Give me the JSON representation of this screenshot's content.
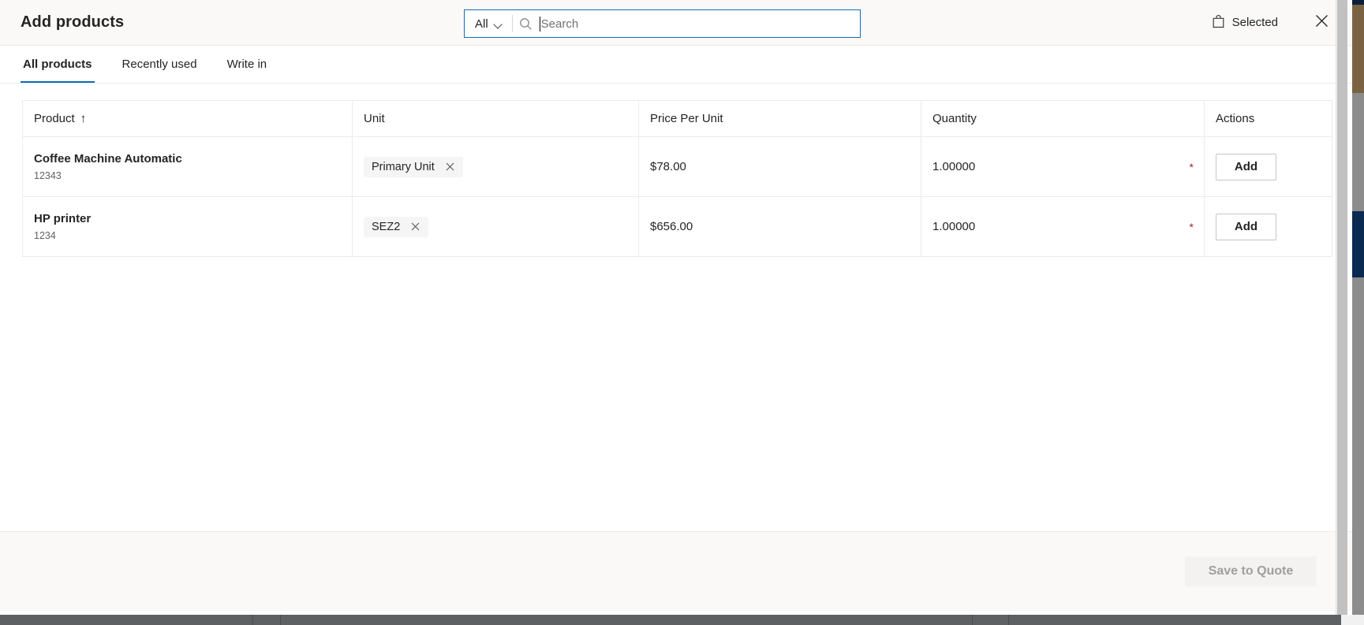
{
  "header": {
    "title": "Add products",
    "search": {
      "scope_label": "All",
      "scope_icon": "chevron-down-icon",
      "search_icon": "search-icon",
      "placeholder": "Search",
      "value": ""
    },
    "selected_label": "Selected",
    "selected_icon": "shopping-bag-icon",
    "close_icon": "close-icon",
    "accent_color": "#0f6cbd"
  },
  "tabs": [
    {
      "label": "All products",
      "active": true
    },
    {
      "label": "Recently used",
      "active": false
    },
    {
      "label": "Write in",
      "active": false
    }
  ],
  "table": {
    "columns": [
      {
        "label": "Product",
        "sort_indicator": "↑"
      },
      {
        "label": "Unit",
        "sort_indicator": ""
      },
      {
        "label": "Price Per Unit",
        "sort_indicator": ""
      },
      {
        "label": "Quantity",
        "sort_indicator": ""
      },
      {
        "label": "Actions",
        "sort_indicator": ""
      }
    ],
    "rows": [
      {
        "product_name": "Coffee Machine Automatic",
        "product_code": "12343",
        "unit": "Primary Unit",
        "unit_remove_icon": "close-icon",
        "price_per_unit": "$78.00",
        "quantity": "1.00000",
        "required_marker": "*",
        "action_label": "Add"
      },
      {
        "product_name": "HP printer",
        "product_code": "1234",
        "unit": "SEZ2",
        "unit_remove_icon": "close-icon",
        "price_per_unit": "$656.00",
        "quantity": "1.00000",
        "required_marker": "*",
        "action_label": "Add"
      }
    ]
  },
  "footer": {
    "save_label": "Save to Quote",
    "save_disabled": true,
    "disabled_text_color": "#a19f9d"
  }
}
